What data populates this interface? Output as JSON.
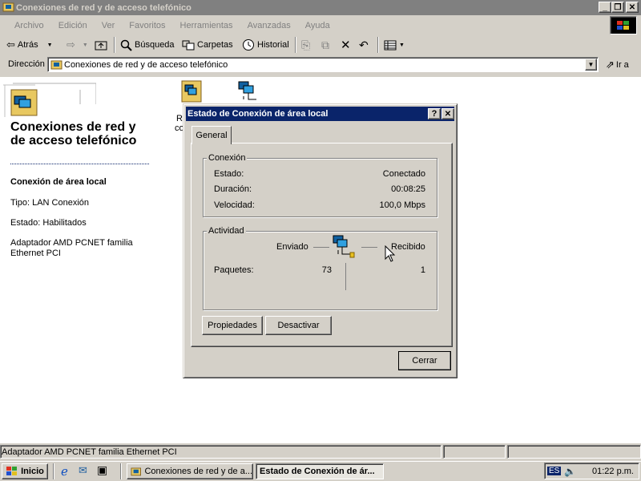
{
  "window": {
    "title": "Conexiones de red y de acceso telefónico",
    "controls": {
      "minimize": "_",
      "maximize": "❐",
      "close": "✕"
    }
  },
  "menu": [
    "Archivo",
    "Edición",
    "Ver",
    "Favoritos",
    "Herramientas",
    "Avanzadas",
    "Ayuda"
  ],
  "toolbar": {
    "back": "Atrás",
    "search": "Búsqueda",
    "folders": "Carpetas",
    "history": "Historial"
  },
  "address": {
    "label": "Dirección",
    "value": "Conexiones de red y de acceso telefónico",
    "go": "Ir a"
  },
  "left_pane": {
    "title": "Conexiones de red y de acceso telefónico",
    "heading": "Conexión de área local",
    "type": "Tipo: LAN Conexión",
    "state": "Estado: Habilitados",
    "adapter": "Adaptador AMD PCNET familia Ethernet PCI"
  },
  "content_icons": {
    "label_fragment_1": "R",
    "label_fragment_2": "co"
  },
  "statusbar": {
    "text": "Adaptador AMD PCNET familia Ethernet PCI"
  },
  "dialog": {
    "title": "Estado de Conexión de área local",
    "help": "?",
    "close": "✕",
    "tab": "General",
    "connection_group": "Conexión",
    "rows": [
      {
        "label": "Estado:",
        "value": "Conectado"
      },
      {
        "label": "Duración:",
        "value": "00:08:25"
      },
      {
        "label": "Velocidad:",
        "value": "100,0 Mbps"
      }
    ],
    "activity_group": "Actividad",
    "sent_label": "Enviado",
    "received_label": "Recibido",
    "packets_label": "Paquetes:",
    "packets_sent": "73",
    "packets_received": "1",
    "properties_button": "Propiedades",
    "disable_button": "Desactivar",
    "close_button": "Cerrar"
  },
  "taskbar": {
    "start": "Inicio",
    "tasks": [
      "Conexiones de red y de a...",
      "Estado de Conexión de ár..."
    ],
    "language": "ES",
    "clock": "01:22 p.m."
  },
  "colors": {
    "title_active": "#0a246a",
    "title_inactive": "#808080",
    "face": "#d4d0c8"
  }
}
